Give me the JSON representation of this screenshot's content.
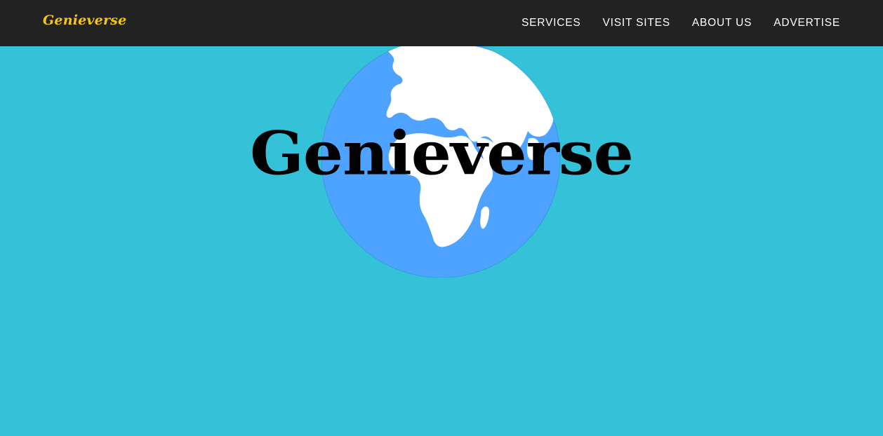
{
  "navbar": {
    "brand": "Genieverse",
    "items": [
      {
        "label": "SERVICES"
      },
      {
        "label": "VISIT SITES"
      },
      {
        "label": "ABOUT US"
      },
      {
        "label": "ADVERTISE"
      }
    ]
  },
  "hero": {
    "title": "Genieverse",
    "globe_icon": "globe-icon"
  },
  "colors": {
    "navbar_bg": "#222222",
    "brand": "#f5c518",
    "page_bg": "#35c2d9",
    "globe_ocean": "#4da3ff",
    "globe_land": "#ffffff"
  }
}
